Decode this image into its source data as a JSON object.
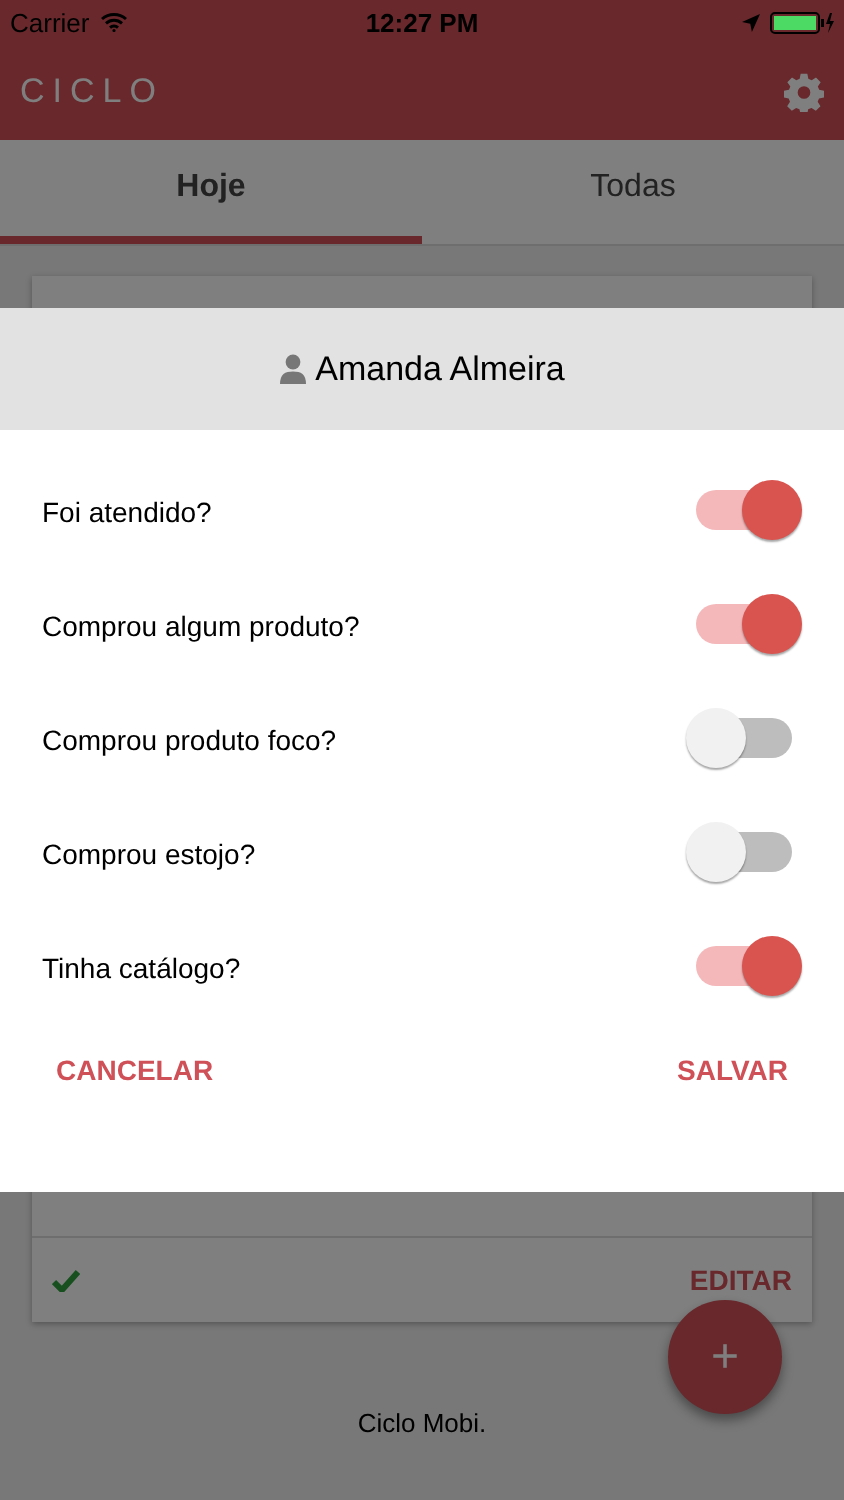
{
  "status_bar": {
    "carrier": "Carrier",
    "time": "12:27 PM"
  },
  "header": {
    "title": "CICLO"
  },
  "tabs": [
    {
      "label": "Hoje",
      "selected": true
    },
    {
      "label": "Todas",
      "selected": false
    }
  ],
  "card": {
    "action": "EDITAR"
  },
  "fab": {
    "symbol": "+"
  },
  "footer": "Ciclo Mobi.",
  "dialog": {
    "title": "Amanda Almeira",
    "questions": [
      {
        "label": "Foi atendido?",
        "on": true
      },
      {
        "label": "Comprou algum produto?",
        "on": true
      },
      {
        "label": "Comprou produto foco?",
        "on": false
      },
      {
        "label": "Comprou estojo?",
        "on": false
      },
      {
        "label": "Tinha catálogo?",
        "on": true
      }
    ],
    "buttons": [
      "CANCELAR",
      "SALVAR"
    ]
  }
}
